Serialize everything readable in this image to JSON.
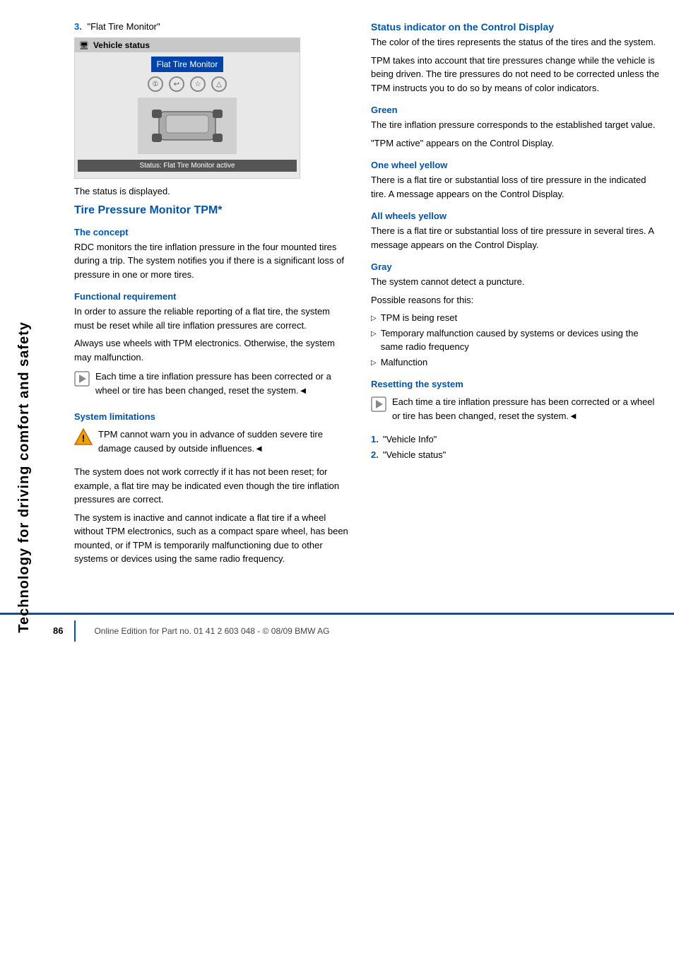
{
  "sidebar": {
    "text": "Technology for driving comfort and safety"
  },
  "left": {
    "step3_label": "3.",
    "step3_text": "\"Flat Tire Monitor\"",
    "vehicle_status": {
      "header": "Vehicle status",
      "menu_item": "Flat Tire Monitor",
      "icons": [
        "①",
        "↩",
        "☆",
        "△"
      ],
      "status_bar": "Status: Flat Tire Monitor active"
    },
    "status_displayed": "The status is displayed.",
    "section_title": "Tire Pressure Monitor TPM*",
    "concept_heading": "The concept",
    "concept_text1": "RDC monitors the tire inflation pressure in the four mounted tires during a trip. The system notifies you if there is a significant loss of pressure in one or more tires.",
    "functional_heading": "Functional requirement",
    "functional_text1": "In order to assure the reliable reporting of a flat tire, the system must be reset while all tire inflation pressures are correct.",
    "functional_text2": "Always use wheels with TPM electronics. Otherwise, the system may malfunction.",
    "note1_text": "Each time a tire inflation pressure has been corrected or a wheel or tire has been changed, reset the system.◄",
    "system_limitations_heading": "System limitations",
    "warning_text": "TPM cannot warn you in advance of sudden severe tire damage caused by outside influences.◄",
    "sys_lim_text1": "The system does not work correctly if it has not been reset; for example, a flat tire may be indicated even though the tire inflation pressures are correct.",
    "sys_lim_text2": "The system is inactive and cannot indicate a flat tire if a wheel without TPM electronics, such as a compact spare wheel, has been mounted, or if TPM is temporarily malfunctioning due to other systems or devices using the same radio frequency."
  },
  "right": {
    "status_indicator_heading": "Status indicator on the Control Display",
    "status_intro_text1": "The color of the tires represents the status of the tires and the system.",
    "status_intro_text2": "TPM takes into account that tire pressures change while the vehicle is being driven. The tire pressures do not need to be corrected unless the TPM instructs you to do so by means of color indicators.",
    "green_heading": "Green",
    "green_text1": "The tire inflation pressure corresponds to the established target value.",
    "green_text2": "\"TPM active\" appears on the Control Display.",
    "one_wheel_yellow_heading": "One wheel yellow",
    "one_wheel_yellow_text": "There is a flat tire or substantial loss of tire pressure in the indicated tire. A message appears on the Control Display.",
    "all_wheels_yellow_heading": "All wheels yellow",
    "all_wheels_yellow_text": "There is a flat tire or substantial loss of tire pressure in several tires. A message appears on the Control Display.",
    "gray_heading": "Gray",
    "gray_text1": "The system cannot detect a puncture.",
    "gray_text2": "Possible reasons for this:",
    "gray_bullets": [
      "TPM is being reset",
      "Temporary malfunction caused by systems or devices using the same radio frequency",
      "Malfunction"
    ],
    "resetting_heading": "Resetting the system",
    "reset_note": "Each time a tire inflation pressure has been corrected or a wheel or tire has been changed, reset the system.◄",
    "reset_list": [
      {
        "num": "1.",
        "text": "\"Vehicle Info\""
      },
      {
        "num": "2.",
        "text": "\"Vehicle status\""
      }
    ]
  },
  "footer": {
    "page_number": "86",
    "footer_text": "Online Edition for Part no. 01 41 2 603 048 - © 08/09 BMW AG"
  }
}
